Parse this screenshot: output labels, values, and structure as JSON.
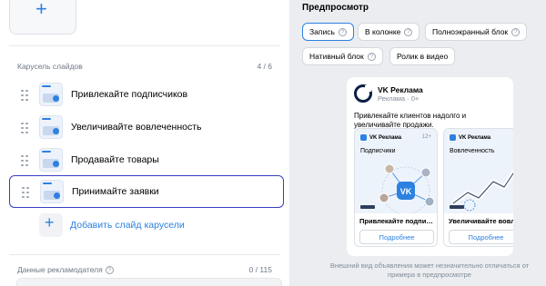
{
  "carousel": {
    "section_label": "Карусель слайдов",
    "counter": "4 / 6",
    "slides": [
      {
        "title": "Привлекайте подписчиков"
      },
      {
        "title": "Увеличивайте вовлеченность"
      },
      {
        "title": "Продавайте товары"
      },
      {
        "title": "Принимайте заявки"
      }
    ],
    "add_slide_label": "Добавить слайд карусели"
  },
  "advertiser": {
    "label": "Данные рекламодателя",
    "counter": "0 / 115"
  },
  "preview": {
    "title": "Предпросмотр",
    "formats": [
      {
        "label": "Запись",
        "active": true
      },
      {
        "label": "В колонке"
      },
      {
        "label": "Полноэкранный блок"
      },
      {
        "label": "Нативный блок"
      },
      {
        "label": "Ролик в видео"
      }
    ],
    "post": {
      "brand_name": "VK Реклама",
      "brand_sub": "Реклама · 0+",
      "text": "Привлекайте клиентов надолго и увеличивайте продажи.",
      "cards": [
        {
          "header": "VK Реклама",
          "age": "12+",
          "label": "Подписчики",
          "caption": "Привлекайте подписчиков",
          "button": "Подробнее"
        },
        {
          "header": "VK Реклама",
          "label": "Вовлеченность",
          "caption": "Увеличивайте вовлеченность",
          "button": "Подробнее"
        }
      ]
    },
    "note": "Внешний вид объявления может незначительно отличаться от примера в предпросмотре"
  },
  "colors": {
    "accent": "#2d81e0",
    "selected_border": "#3a3fc2",
    "background": "#ebedf0"
  }
}
